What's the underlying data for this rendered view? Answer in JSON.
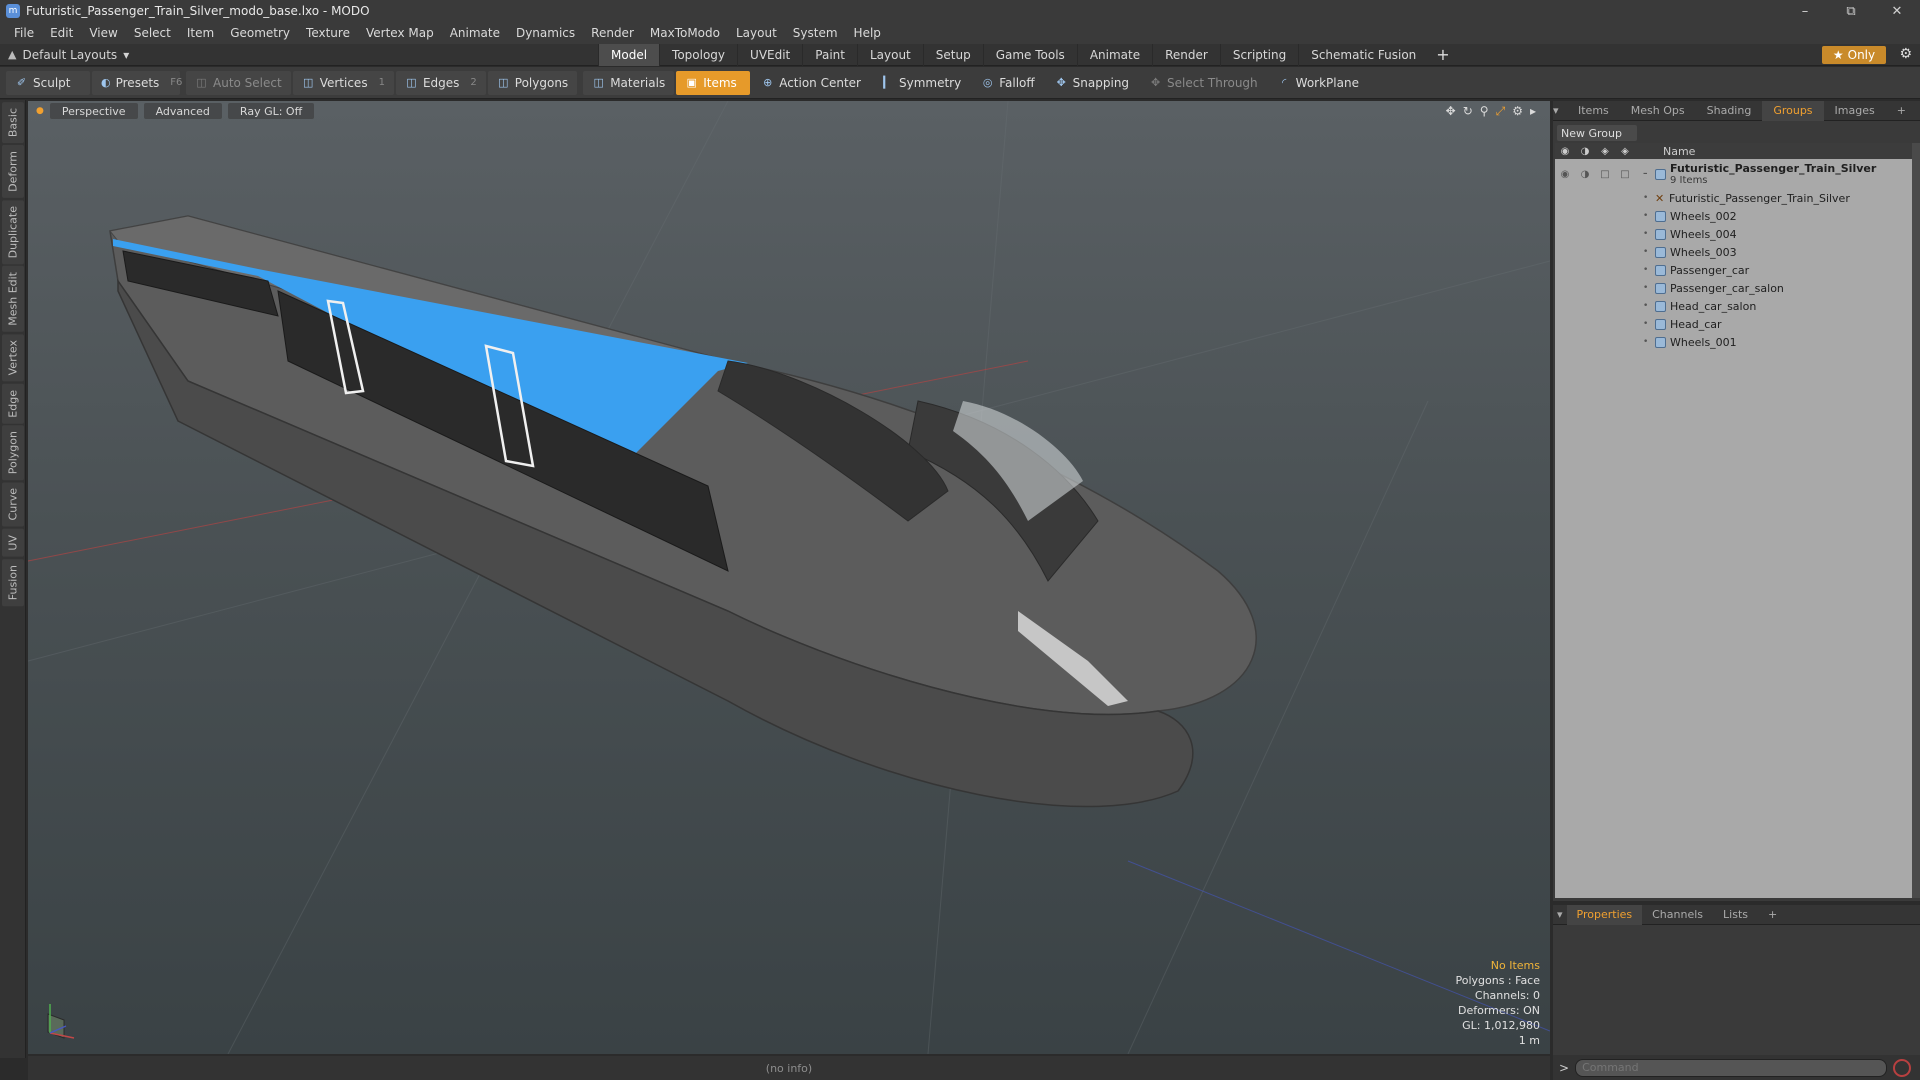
{
  "window": {
    "title": "Futuristic_Passenger_Train_Silver_modo_base.lxo - MODO",
    "app_icon": "modo-icon",
    "controls": [
      "minimize-icon",
      "restore-icon",
      "close-icon"
    ]
  },
  "menu": [
    "File",
    "Edit",
    "View",
    "Select",
    "Item",
    "Geometry",
    "Texture",
    "Vertex Map",
    "Animate",
    "Dynamics",
    "Render",
    "MaxToModo",
    "Layout",
    "System",
    "Help"
  ],
  "layout_selector": "Default Layouts",
  "main_tabs": [
    {
      "label": "Model",
      "active": true
    },
    {
      "label": "Topology"
    },
    {
      "label": "UVEdit"
    },
    {
      "label": "Paint"
    },
    {
      "label": "Layout"
    },
    {
      "label": "Setup"
    },
    {
      "label": "Game Tools"
    },
    {
      "label": "Animate"
    },
    {
      "label": "Render"
    },
    {
      "label": "Scripting"
    },
    {
      "label": "Schematic Fusion"
    }
  ],
  "only_button": "Only",
  "toolbar": {
    "sculpt": "Sculpt",
    "presets": "Presets",
    "presets_key": "F6",
    "auto_select": "Auto Select",
    "vertices": "Vertices",
    "vertices_count": "1",
    "edges": "Edges",
    "edges_count": "2",
    "polygons": "Polygons",
    "materials": "Materials",
    "items": "Items",
    "action_center": "Action Center",
    "symmetry": "Symmetry",
    "falloff": "Falloff",
    "snapping": "Snapping",
    "select_through": "Select Through",
    "workplane": "WorkPlane"
  },
  "left_tabs": [
    "Basic",
    "Deform",
    "Duplicate",
    "Mesh Edit",
    "Vertex",
    "Edge",
    "Polygon",
    "Curve",
    "UV",
    "Fusion"
  ],
  "viewport": {
    "view": "Perspective",
    "shading": "Advanced",
    "raygl": "Ray GL: Off",
    "info": {
      "items": "No Items",
      "polygons": "Polygons : Face",
      "channels": "Channels: 0",
      "deformers": "Deformers: ON",
      "gl": "GL: 1,012,980",
      "scale": "1 m"
    }
  },
  "status_bar": "(no info)",
  "right_panel": {
    "tabs": [
      {
        "label": "Items"
      },
      {
        "label": "Mesh Ops"
      },
      {
        "label": "Shading"
      },
      {
        "label": "Groups",
        "active": true
      },
      {
        "label": "Images"
      }
    ],
    "new_group": "New Group",
    "name_header": "Name",
    "group": {
      "name": "Futuristic_Passenger_Train_Silver",
      "count": "9 Items"
    },
    "items": [
      {
        "label": "Futuristic_Passenger_Train_Silver",
        "icon": "locator-icon"
      },
      {
        "label": "Wheels_002",
        "icon": "mesh-icon"
      },
      {
        "label": "Wheels_004",
        "icon": "mesh-icon"
      },
      {
        "label": "Wheels_003",
        "icon": "mesh-icon"
      },
      {
        "label": "Passenger_car",
        "icon": "mesh-icon"
      },
      {
        "label": "Passenger_car_salon",
        "icon": "mesh-icon"
      },
      {
        "label": "Head_car_salon",
        "icon": "mesh-icon"
      },
      {
        "label": "Head_car",
        "icon": "mesh-icon"
      },
      {
        "label": "Wheels_001",
        "icon": "mesh-icon"
      }
    ]
  },
  "properties_panel": {
    "tabs": [
      {
        "label": "Properties",
        "active": true
      },
      {
        "label": "Channels"
      },
      {
        "label": "Lists"
      }
    ]
  },
  "command": {
    "prompt": ">",
    "placeholder": "Command"
  },
  "colors": {
    "accent": "#e69a2a",
    "active_tab_text": "#f0a030",
    "train_stripe": "#3aa0f0"
  }
}
